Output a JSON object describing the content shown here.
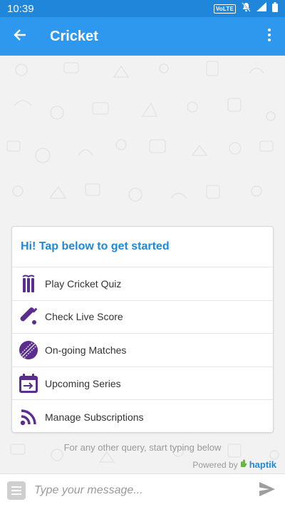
{
  "status_bar": {
    "time": "10:39",
    "volte": "VoLTE"
  },
  "app_bar": {
    "title": "Cricket"
  },
  "card": {
    "title": "Hi! Tap below to get started",
    "items": [
      {
        "label": "Play Cricket Quiz",
        "icon": "stumps-icon"
      },
      {
        "label": "Check Live Score",
        "icon": "cricket-bat-icon"
      },
      {
        "label": "On-going Matches",
        "icon": "cricket-ball-icon"
      },
      {
        "label": "Upcoming Series",
        "icon": "calendar-arrow-icon"
      },
      {
        "label": "Manage Subscriptions",
        "icon": "rss-icon"
      }
    ]
  },
  "hint": "For any other query, start typing below",
  "powered_by": {
    "text": "Powered by",
    "brand": "haptik"
  },
  "input": {
    "placeholder": "Type your message..."
  },
  "colors": {
    "app_bar": "#2d98ee",
    "status_bar": "#1f86d9",
    "accent": "#1e8ad6",
    "icon_purple": "#5b2d8e"
  }
}
